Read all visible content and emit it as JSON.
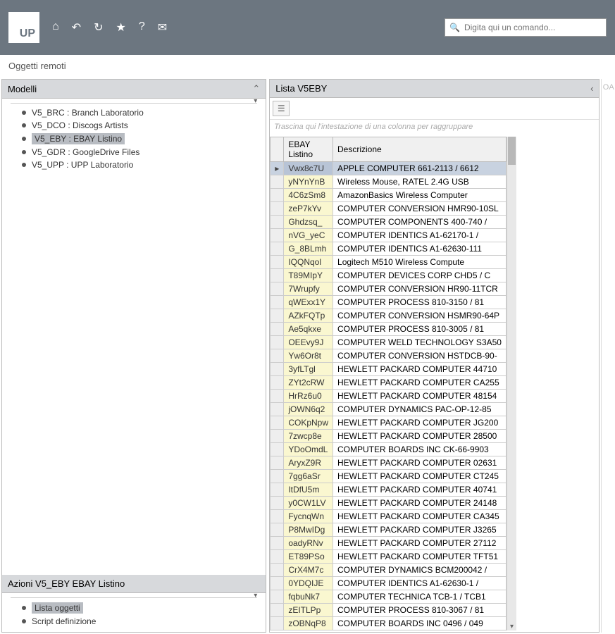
{
  "topbar": {
    "logo_text": "UP",
    "search_placeholder": "Digita qui un comando..."
  },
  "breadcrumb": "Oggetti remoti",
  "modelli": {
    "title": "Modelli",
    "items": [
      {
        "label": "V5_BRC : Branch Laboratorio",
        "selected": false
      },
      {
        "label": "V5_DCO : Discogs Artists",
        "selected": false
      },
      {
        "label": "V5_EBY : EBAY Listino",
        "selected": true
      },
      {
        "label": "V5_GDR : GoogleDrive Files",
        "selected": false
      },
      {
        "label": "V5_UPP : UPP Laboratorio",
        "selected": false
      }
    ]
  },
  "azioni": {
    "title": "Azioni V5_EBY EBAY Listino",
    "items": [
      {
        "label": "Lista oggetti",
        "selected": true
      },
      {
        "label": "Script definizione",
        "selected": false
      }
    ]
  },
  "lista": {
    "title": "Lista V5EBY",
    "group_hint": "Trascina qui l'intestazione di una colonna per raggruppare",
    "columns": [
      "EBAY Listino",
      "Descrizione"
    ],
    "rows": [
      {
        "id": "Vwx8c7U",
        "desc": "APPLE COMPUTER 661-2113 / 6612",
        "selected": true
      },
      {
        "id": "yNYnYnB",
        "desc": "Wireless Mouse, RATEL 2.4G USB"
      },
      {
        "id": "4C6zSm8",
        "desc": "AmazonBasics Wireless Computer"
      },
      {
        "id": "zeP7kYv",
        "desc": "COMPUTER CONVERSION HMR90-10SL"
      },
      {
        "id": "Ghdzsq_",
        "desc": "COMPUTER COMPONENTS 400-740 /"
      },
      {
        "id": "nVG_yeC",
        "desc": "COMPUTER IDENTICS A1-62170-1 /"
      },
      {
        "id": "G_8BLmh",
        "desc": "COMPUTER IDENTICS A1-62630-111"
      },
      {
        "id": "IQQNqol",
        "desc": "Logitech M510 Wireless Compute"
      },
      {
        "id": "T89MIpY",
        "desc": "COMPUTER DEVICES CORP CHD5 / C"
      },
      {
        "id": "7Wrupfy",
        "desc": "COMPUTER CONVERSION HR90-11TCR"
      },
      {
        "id": "qWExx1Y",
        "desc": "COMPUTER PROCESS 810-3150 / 81"
      },
      {
        "id": "AZkFQTp",
        "desc": "COMPUTER CONVERSION HSMR90-64P"
      },
      {
        "id": "Ae5qkxe",
        "desc": "COMPUTER PROCESS 810-3005 / 81"
      },
      {
        "id": "OEEvy9J",
        "desc": "COMPUTER WELD TECHNOLOGY S3A50"
      },
      {
        "id": "Yw6Or8t",
        "desc": "COMPUTER CONVERSION HSTDCB-90-"
      },
      {
        "id": "3yfLTgl",
        "desc": "HEWLETT PACKARD COMPUTER 44710"
      },
      {
        "id": "ZYt2cRW",
        "desc": "HEWLETT PACKARD COMPUTER CA255"
      },
      {
        "id": "HrRz6u0",
        "desc": "HEWLETT PACKARD COMPUTER 48154"
      },
      {
        "id": "jOWN6q2",
        "desc": "COMPUTER DYNAMICS PAC-OP-12-85"
      },
      {
        "id": "COKpNpw",
        "desc": "HEWLETT PACKARD COMPUTER JG200"
      },
      {
        "id": "7zwcp8e",
        "desc": "HEWLETT PACKARD COMPUTER 28500"
      },
      {
        "id": "YDoOmdL",
        "desc": "COMPUTER BOARDS INC CK-66-9903"
      },
      {
        "id": "AryxZ9R",
        "desc": "HEWLETT PACKARD COMPUTER 02631"
      },
      {
        "id": "7gg6aSr",
        "desc": "HEWLETT PACKARD COMPUTER CT245"
      },
      {
        "id": "ItDfU5m",
        "desc": "HEWLETT PACKARD COMPUTER 40741"
      },
      {
        "id": "y0CW1LV",
        "desc": "HEWLETT PACKARD COMPUTER 24148"
      },
      {
        "id": "FycnqWn",
        "desc": "HEWLETT PACKARD COMPUTER CA345"
      },
      {
        "id": "P8MwIDg",
        "desc": "HEWLETT PACKARD COMPUTER J3265"
      },
      {
        "id": "oadyRNv",
        "desc": "HEWLETT PACKARD COMPUTER 27112"
      },
      {
        "id": "ET89PSo",
        "desc": "HEWLETT PACKARD COMPUTER TFT51"
      },
      {
        "id": "CrX4M7c",
        "desc": "COMPUTER DYNAMICS BCM200042 /"
      },
      {
        "id": "0YDQIJE",
        "desc": "COMPUTER IDENTICS A1-62630-1 /"
      },
      {
        "id": "fqbuNk7",
        "desc": "COMPUTER TECHNICA TCB-1 / TCB1"
      },
      {
        "id": "zEITLPp",
        "desc": "COMPUTER PROCESS 810-3067 / 81"
      },
      {
        "id": "zOBNqP8",
        "desc": "COMPUTER BOARDS INC 0496 / 049"
      }
    ]
  },
  "far_right_label": "OA"
}
